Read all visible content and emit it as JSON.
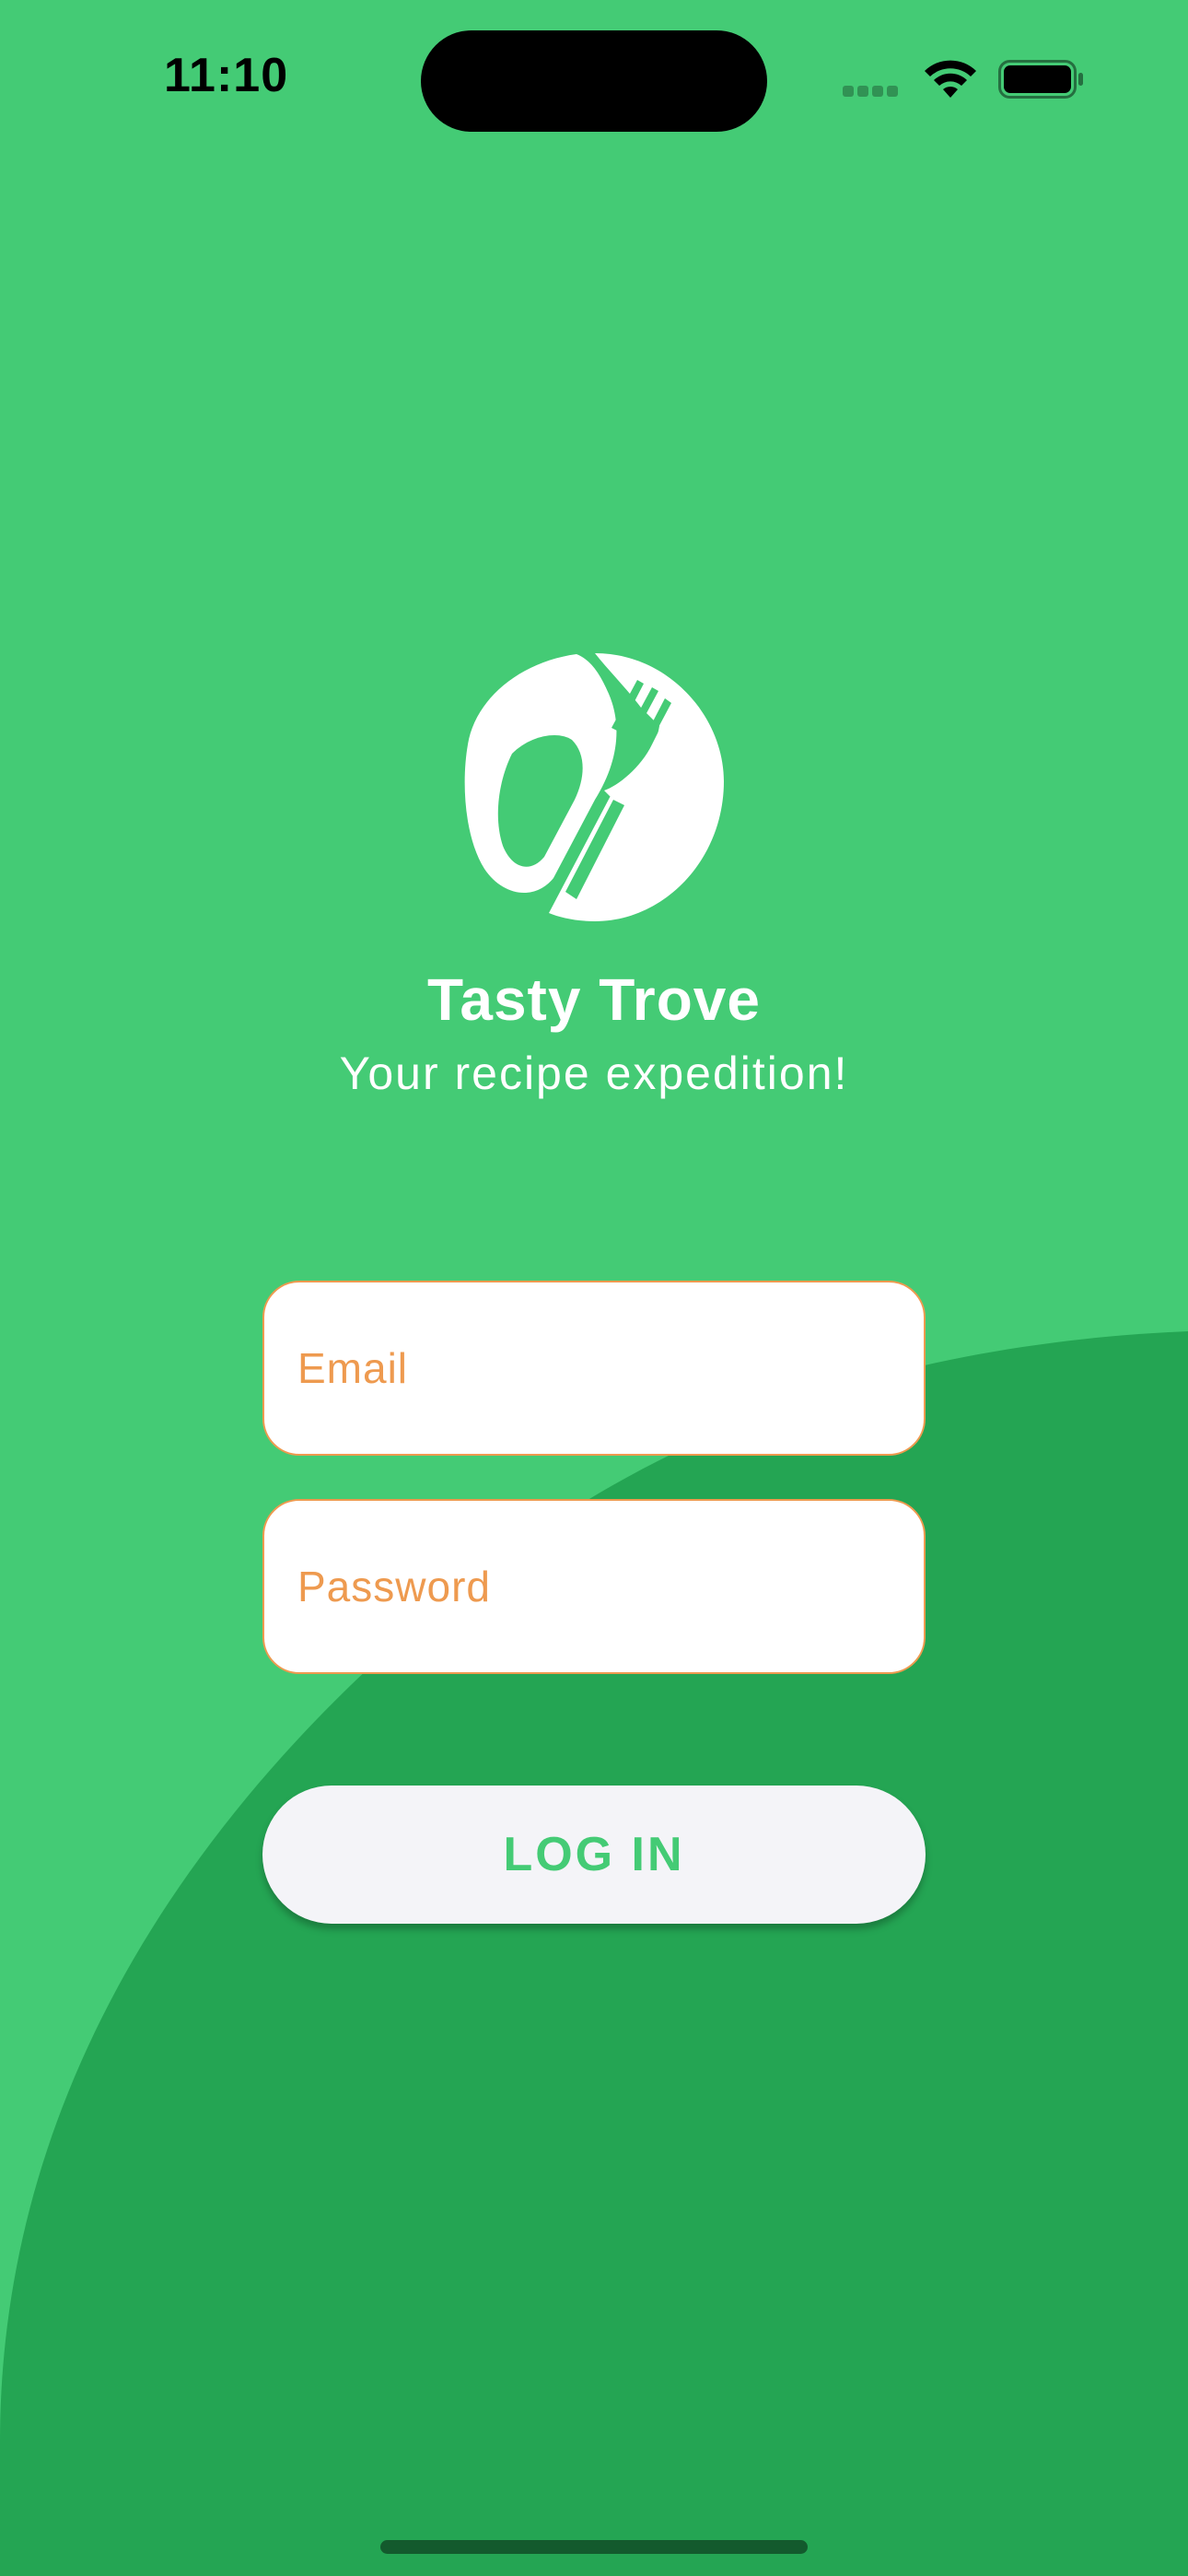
{
  "status_bar": {
    "time": "11:10"
  },
  "app": {
    "title": "Tasty Trove",
    "subtitle": "Your recipe expedition!",
    "logo_icon": "spoon-fork-leaf-logo"
  },
  "login_form": {
    "email_placeholder": "Email",
    "email_value": "",
    "password_placeholder": "Password",
    "password_value": "",
    "login_label": "LOG IN"
  },
  "colors": {
    "background": "#44CB75",
    "background_dark": "#24A553",
    "accent_orange": "#EE9A4F",
    "button_bg": "#F4F4F8",
    "button_text": "#44CB75"
  }
}
